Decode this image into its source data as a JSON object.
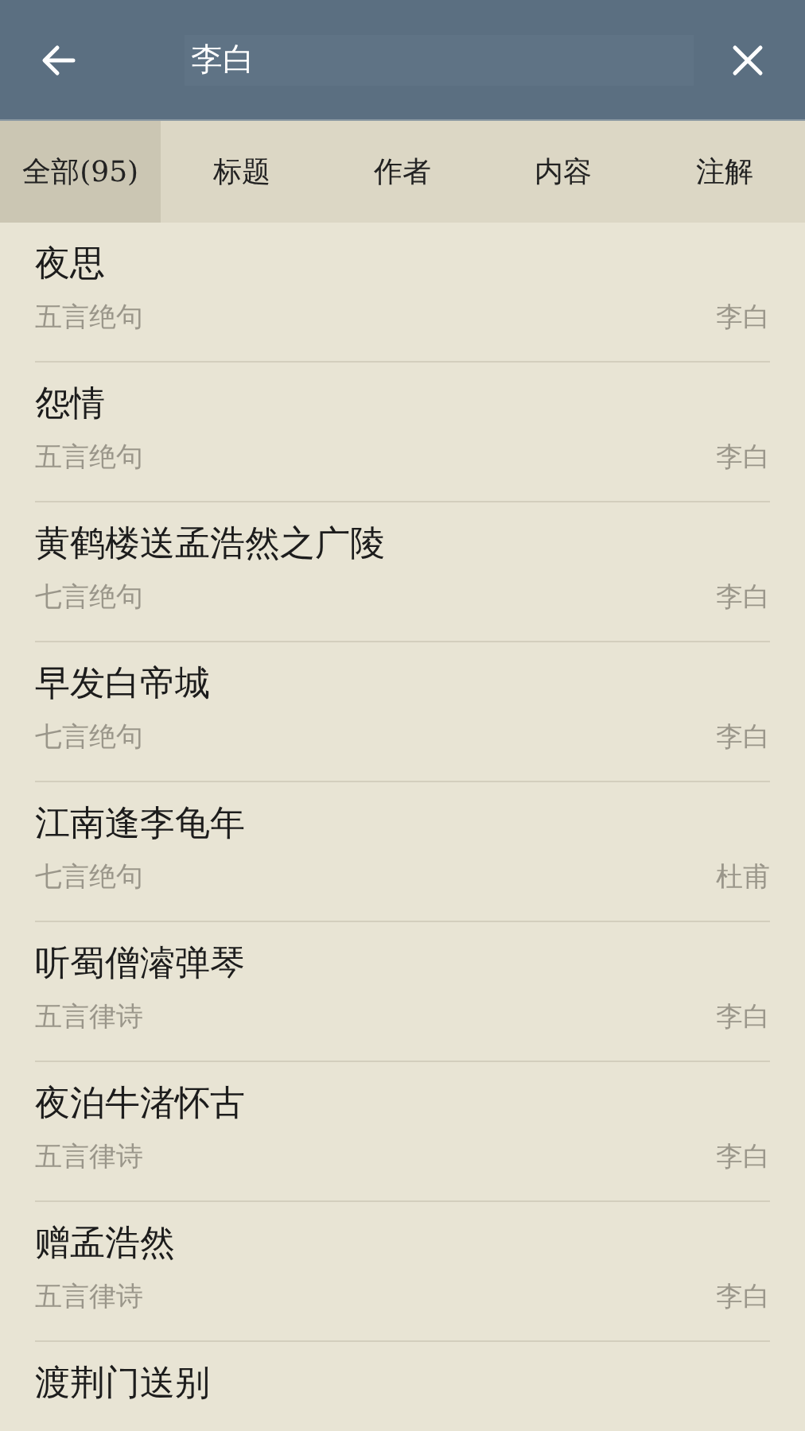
{
  "search": {
    "value": "李白"
  },
  "tabs": [
    {
      "label": "全部(95)",
      "selected": true
    },
    {
      "label": "标题",
      "selected": false
    },
    {
      "label": "作者",
      "selected": false
    },
    {
      "label": "内容",
      "selected": false
    },
    {
      "label": "注解",
      "selected": false
    }
  ],
  "results": [
    {
      "title": "夜思",
      "form": "五言绝句",
      "author": "李白"
    },
    {
      "title": "怨情",
      "form": "五言绝句",
      "author": "李白"
    },
    {
      "title": "黄鹤楼送孟浩然之广陵",
      "form": "七言绝句",
      "author": "李白"
    },
    {
      "title": "早发白帝城",
      "form": "七言绝句",
      "author": "李白"
    },
    {
      "title": "江南逢李龟年",
      "form": "七言绝句",
      "author": "杜甫"
    },
    {
      "title": "听蜀僧濬弹琴",
      "form": "五言律诗",
      "author": "李白"
    },
    {
      "title": "夜泊牛渚怀古",
      "form": "五言律诗",
      "author": "李白"
    },
    {
      "title": "赠孟浩然",
      "form": "五言律诗",
      "author": "李白"
    },
    {
      "title": "渡荆门送别"
    }
  ]
}
